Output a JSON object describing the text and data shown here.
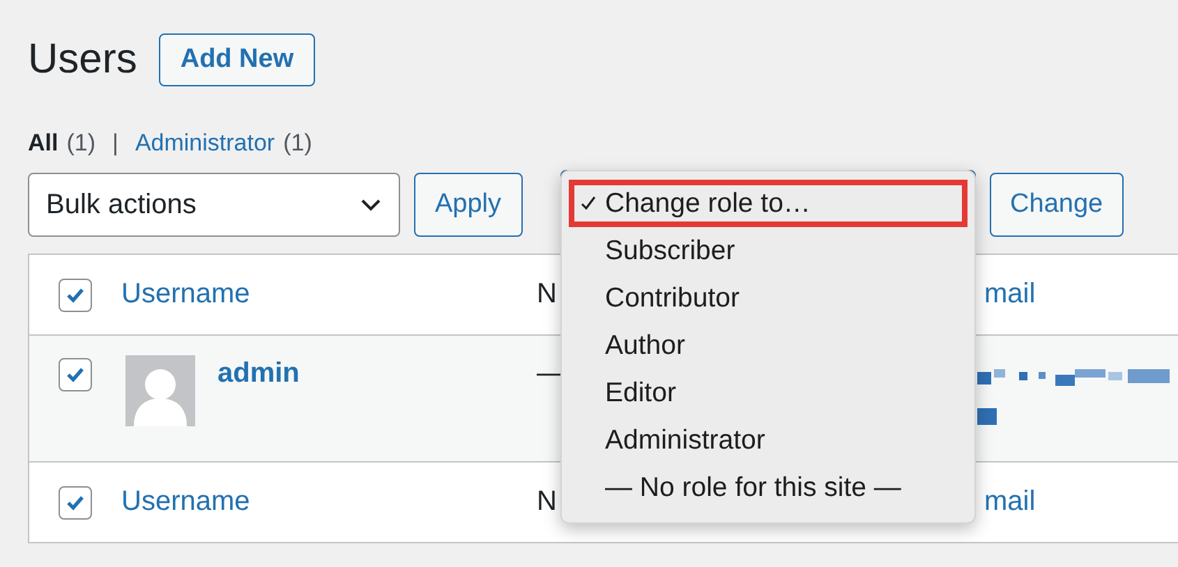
{
  "page": {
    "title": "Users",
    "add_new": "Add New"
  },
  "filters": {
    "separator": "|",
    "items": [
      {
        "label": "All",
        "count": "(1)",
        "selected": true
      },
      {
        "label": "Administrator",
        "count": "(1)",
        "selected": false
      }
    ]
  },
  "bulk_actions": {
    "value": "Bulk actions",
    "apply": "Apply"
  },
  "role_change": {
    "focused": true,
    "button": "Change",
    "menu": [
      {
        "label": "Change role to…",
        "checked": true,
        "highlighted": true
      },
      {
        "label": "Subscriber",
        "checked": false,
        "highlighted": false
      },
      {
        "label": "Contributor",
        "checked": false,
        "highlighted": false
      },
      {
        "label": "Author",
        "checked": false,
        "highlighted": false
      },
      {
        "label": "Editor",
        "checked": false,
        "highlighted": false
      },
      {
        "label": "Administrator",
        "checked": false,
        "highlighted": false
      },
      {
        "label": "— No role for this site —",
        "checked": false,
        "highlighted": false
      }
    ]
  },
  "table": {
    "header": {
      "checked": true,
      "columns": [
        "Username",
        "N",
        "mail"
      ]
    },
    "rows": [
      {
        "checked": true,
        "username": "admin",
        "name": "—",
        "email": {
          "kind": "pixelated"
        }
      }
    ],
    "footer": {
      "checked": true,
      "columns": [
        "Username",
        "N",
        "mail"
      ]
    }
  }
}
